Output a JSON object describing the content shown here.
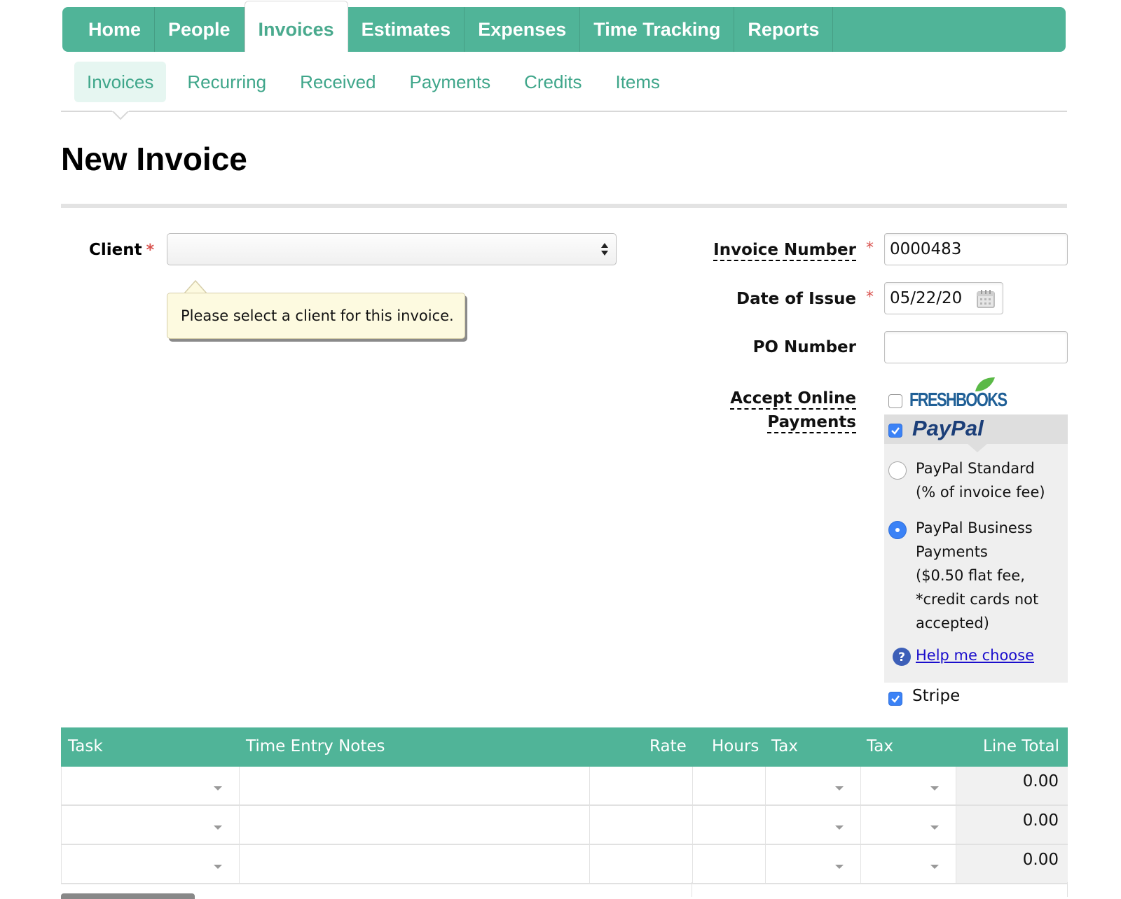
{
  "nav": {
    "tabs": [
      {
        "label": "Home"
      },
      {
        "label": "People"
      },
      {
        "label": "Invoices"
      },
      {
        "label": "Estimates"
      },
      {
        "label": "Expenses"
      },
      {
        "label": "Time Tracking"
      },
      {
        "label": "Reports"
      }
    ],
    "active_tab": "Invoices"
  },
  "subnav": {
    "items": [
      {
        "label": "Invoices"
      },
      {
        "label": "Recurring"
      },
      {
        "label": "Received"
      },
      {
        "label": "Payments"
      },
      {
        "label": "Credits"
      },
      {
        "label": "Items"
      }
    ],
    "active_item": "Invoices"
  },
  "page": {
    "title": "New Invoice"
  },
  "form": {
    "client_label": "Client",
    "client_value": "",
    "client_tooltip": "Please select a client for this invoice.",
    "invoice_number_label": "Invoice Number",
    "invoice_number_value": "0000483",
    "date_label": "Date of Issue",
    "date_value": "05/22/20",
    "po_label": "PO Number",
    "po_value": "",
    "required_mark": "*",
    "online_payments_label_1": "Accept Online",
    "online_payments_label_2": "Payments"
  },
  "payments": {
    "freshbooks_logo": "FreshBooks",
    "freshbooks_checked": false,
    "paypal_logo": "PayPal",
    "paypal_checked": true,
    "paypal_standard_1": "PayPal Standard",
    "paypal_standard_2": "(% of invoice fee)",
    "paypal_standard_selected": false,
    "paypal_business_1": "PayPal Business",
    "paypal_business_2": "Payments",
    "paypal_business_3": "($0.50 flat fee,",
    "paypal_business_4": "*credit cards not",
    "paypal_business_5": "accepted)",
    "paypal_business_selected": true,
    "help_link": "Help me choose",
    "stripe_label": "Stripe",
    "stripe_checked": true
  },
  "table": {
    "headers": {
      "task": "Task",
      "notes": "Time Entry Notes",
      "rate": "Rate",
      "hours": "Hours",
      "tax1": "Tax",
      "tax2": "Tax",
      "line_total": "Line Total"
    },
    "rows": [
      {
        "line_total": "0.00"
      },
      {
        "line_total": "0.00"
      },
      {
        "line_total": "0.00"
      }
    ]
  },
  "colors": {
    "brand_green": "#50b498",
    "link_green": "#3fa68a",
    "required_red": "#d9534f",
    "checkbox_blue": "#3b82f6"
  }
}
